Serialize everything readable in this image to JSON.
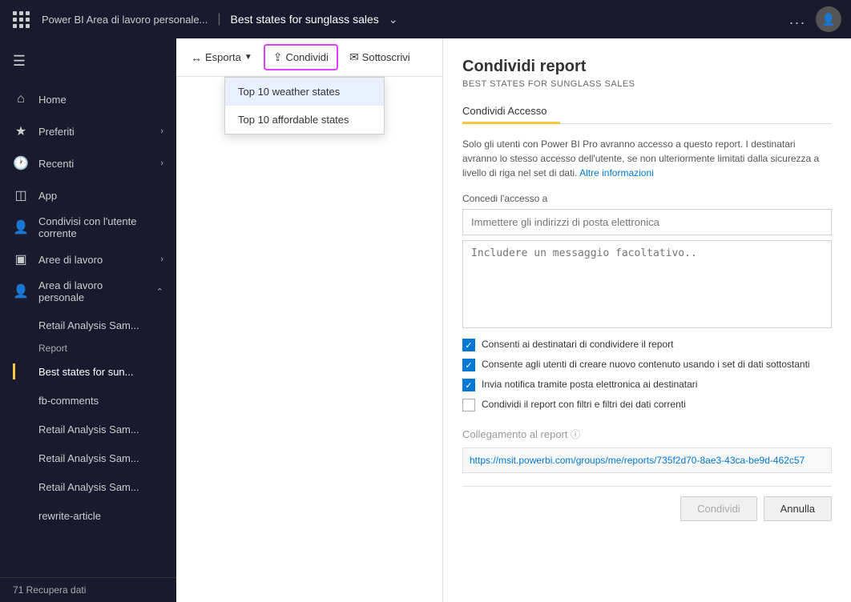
{
  "topbar": {
    "app_name": "Power BI Area di lavoro personale...",
    "report_title": "Best states for sunglass sales",
    "separator": "|",
    "ellipsis": "...",
    "avatar_initial": ""
  },
  "sidebar": {
    "home_label": "Home",
    "preferiti_label": "Preferiti",
    "recenti_label": "Recenti",
    "app_label": "App",
    "condivisi_label": "Condivisi con l'utente corrente",
    "aree_label": "Aree di lavoro",
    "area_personale_label": "Area di lavoro personale",
    "retail_sam1": "Retail Analysis Sam...",
    "report_section": "Report",
    "best_states": "Best states for sun...",
    "fb_comments": "fb-comments",
    "retail_sam2": "Retail Analysis Sam...",
    "retail_sam3": "Retail Analysis Sam...",
    "retail_sam4": "Retail Analysis Sam...",
    "rewrite_article": "rewrite-article",
    "footer_label": "71 Recupera dati"
  },
  "toolbar": {
    "esporta_label": "Esporta",
    "condividi_label": "Condividi",
    "sottoscrivi_label": "Sottoscrivi"
  },
  "dropdown": {
    "items": [
      "Top 10 weather states",
      "Top 10 affordable states"
    ]
  },
  "panel": {
    "title": "Condividi report",
    "subtitle": "BEST STATES FOR SUNGLASS SALES",
    "tab_condividi": "Condividi Accesso",
    "info_text": "Solo gli utenti con Power BI Pro avranno accesso a questo report. I destinatari avranno lo stesso accesso dell'utente, se non ulteriormente limitati dalla sicurezza a livello di riga nel set di dati.",
    "info_link": "Altre informazioni",
    "label_access": "Concedi l'accesso a",
    "email_placeholder": "Immettere gli indirizzi di posta elettronica",
    "message_placeholder": "Includere un messaggio facoltativo..",
    "checkbox1": "Consenti ai destinatari di condividere il report",
    "checkbox2": "Consente agli utenti di creare nuovo contenuto usando i set di dati sottostanti",
    "checkbox3": "Invia notifica tramite posta elettronica ai destinatari",
    "checkbox4": "Condividi il report con filtri e filtri dei dati correnti",
    "link_label": "Collegamento al report",
    "link_url": "https://msit.powerbi.com/groups/me/reports/735f2d70-8ae3-43ca-be9d-462c57",
    "btn_condividi": "Condividi",
    "btn_annulla": "Annulla"
  }
}
